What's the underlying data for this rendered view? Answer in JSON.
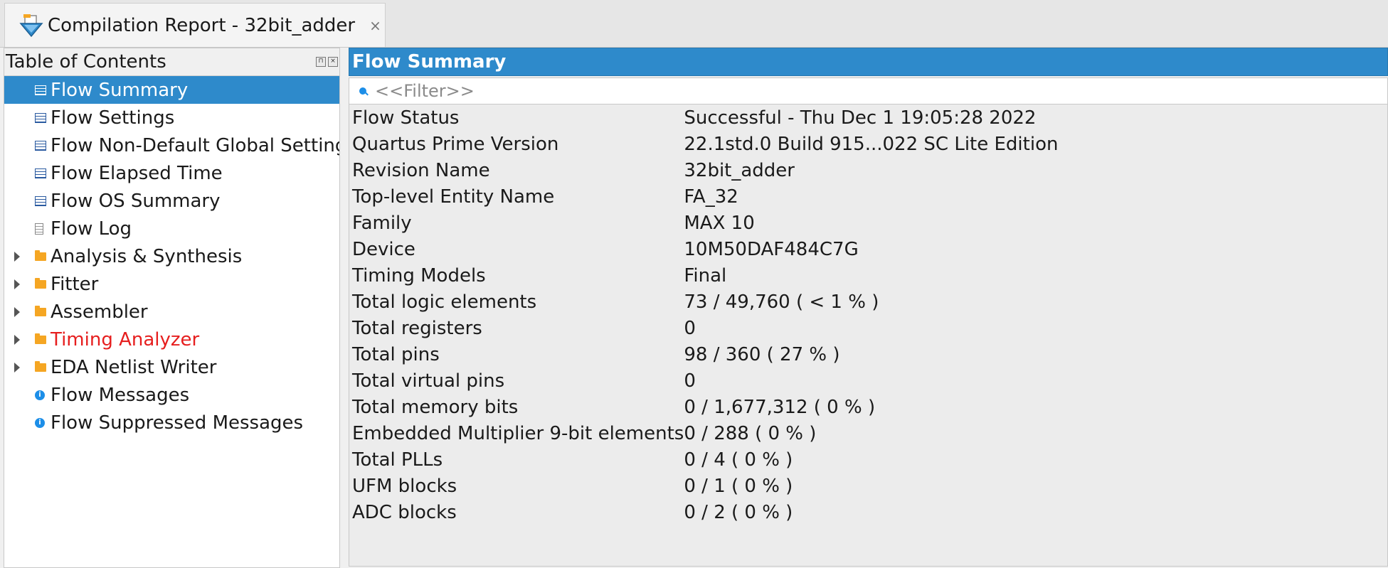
{
  "tab": {
    "title": "Compilation Report - 32bit_adder",
    "close_glyph": "×"
  },
  "toc": {
    "title": "Table of Contents",
    "items": [
      {
        "label": "Flow Summary",
        "icon": "table-icon",
        "selected": true,
        "expandable": false
      },
      {
        "label": "Flow Settings",
        "icon": "table-icon",
        "selected": false,
        "expandable": false
      },
      {
        "label": "Flow Non-Default Global Settings",
        "icon": "table-icon",
        "selected": false,
        "expandable": false
      },
      {
        "label": "Flow Elapsed Time",
        "icon": "table-icon",
        "selected": false,
        "expandable": false
      },
      {
        "label": "Flow OS Summary",
        "icon": "table-icon",
        "selected": false,
        "expandable": false
      },
      {
        "label": "Flow Log",
        "icon": "document-icon",
        "selected": false,
        "expandable": false
      },
      {
        "label": "Analysis & Synthesis",
        "icon": "folder-icon",
        "selected": false,
        "expandable": true
      },
      {
        "label": "Fitter",
        "icon": "folder-icon",
        "selected": false,
        "expandable": true
      },
      {
        "label": "Assembler",
        "icon": "folder-icon",
        "selected": false,
        "expandable": true
      },
      {
        "label": "Timing Analyzer",
        "icon": "folder-icon",
        "selected": false,
        "expandable": true,
        "color": "#e61e1e"
      },
      {
        "label": "EDA Netlist Writer",
        "icon": "folder-icon",
        "selected": false,
        "expandable": true
      },
      {
        "label": "Flow Messages",
        "icon": "info-icon",
        "selected": false,
        "expandable": false
      },
      {
        "label": "Flow Suppressed Messages",
        "icon": "info-icon",
        "selected": false,
        "expandable": false
      }
    ]
  },
  "main": {
    "title": "Flow Summary",
    "filter_placeholder": "<<Filter>>",
    "rows": [
      {
        "key": "Flow Status",
        "value": "Successful - Thu Dec  1 19:05:28 2022"
      },
      {
        "key": "Quartus Prime Version",
        "value": "22.1std.0 Build 915...022 SC Lite Edition"
      },
      {
        "key": "Revision Name",
        "value": "32bit_adder"
      },
      {
        "key": "Top-level Entity Name",
        "value": "FA_32"
      },
      {
        "key": "Family",
        "value": "MAX 10"
      },
      {
        "key": "Device",
        "value": "10M50DAF484C7G"
      },
      {
        "key": "Timing Models",
        "value": "Final"
      },
      {
        "key": "Total logic elements",
        "value": "73 / 49,760 ( < 1 % )"
      },
      {
        "key": "Total registers",
        "value": "0"
      },
      {
        "key": "Total pins",
        "value": "98 / 360 ( 27 % )"
      },
      {
        "key": "Total virtual pins",
        "value": "0"
      },
      {
        "key": "Total memory bits",
        "value": "0 / 1,677,312 ( 0 % )"
      },
      {
        "key": "Embedded Multiplier 9-bit elements",
        "value": "0 / 288 ( 0 % )"
      },
      {
        "key": "Total PLLs",
        "value": "0 / 4 ( 0 % )"
      },
      {
        "key": "UFM blocks",
        "value": "0 / 1 ( 0 % )"
      },
      {
        "key": "ADC blocks",
        "value": "0 / 2 ( 0 % )"
      }
    ]
  },
  "colors": {
    "accent": "#2e8acb",
    "warning_text": "#e61e1e",
    "folder": "#f5a623",
    "info": "#1c8ee8"
  }
}
